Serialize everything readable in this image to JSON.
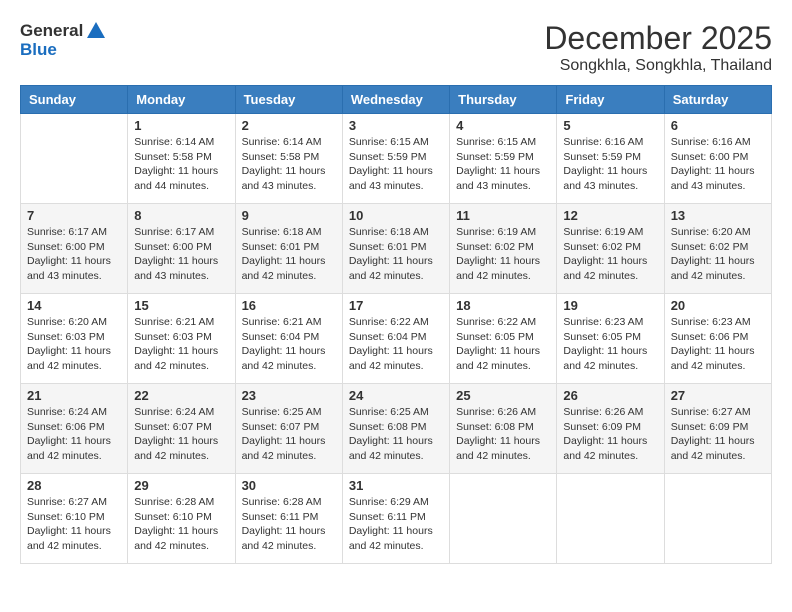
{
  "logo": {
    "general": "General",
    "blue": "Blue"
  },
  "header": {
    "month": "December 2025",
    "location": "Songkhla, Songkhla, Thailand"
  },
  "weekdays": [
    "Sunday",
    "Monday",
    "Tuesday",
    "Wednesday",
    "Thursday",
    "Friday",
    "Saturday"
  ],
  "weeks": [
    [
      {
        "day": "",
        "info": ""
      },
      {
        "day": "1",
        "info": "Sunrise: 6:14 AM\nSunset: 5:58 PM\nDaylight: 11 hours\nand 44 minutes."
      },
      {
        "day": "2",
        "info": "Sunrise: 6:14 AM\nSunset: 5:58 PM\nDaylight: 11 hours\nand 43 minutes."
      },
      {
        "day": "3",
        "info": "Sunrise: 6:15 AM\nSunset: 5:59 PM\nDaylight: 11 hours\nand 43 minutes."
      },
      {
        "day": "4",
        "info": "Sunrise: 6:15 AM\nSunset: 5:59 PM\nDaylight: 11 hours\nand 43 minutes."
      },
      {
        "day": "5",
        "info": "Sunrise: 6:16 AM\nSunset: 5:59 PM\nDaylight: 11 hours\nand 43 minutes."
      },
      {
        "day": "6",
        "info": "Sunrise: 6:16 AM\nSunset: 6:00 PM\nDaylight: 11 hours\nand 43 minutes."
      }
    ],
    [
      {
        "day": "7",
        "info": "Sunrise: 6:17 AM\nSunset: 6:00 PM\nDaylight: 11 hours\nand 43 minutes."
      },
      {
        "day": "8",
        "info": "Sunrise: 6:17 AM\nSunset: 6:00 PM\nDaylight: 11 hours\nand 43 minutes."
      },
      {
        "day": "9",
        "info": "Sunrise: 6:18 AM\nSunset: 6:01 PM\nDaylight: 11 hours\nand 42 minutes."
      },
      {
        "day": "10",
        "info": "Sunrise: 6:18 AM\nSunset: 6:01 PM\nDaylight: 11 hours\nand 42 minutes."
      },
      {
        "day": "11",
        "info": "Sunrise: 6:19 AM\nSunset: 6:02 PM\nDaylight: 11 hours\nand 42 minutes."
      },
      {
        "day": "12",
        "info": "Sunrise: 6:19 AM\nSunset: 6:02 PM\nDaylight: 11 hours\nand 42 minutes."
      },
      {
        "day": "13",
        "info": "Sunrise: 6:20 AM\nSunset: 6:02 PM\nDaylight: 11 hours\nand 42 minutes."
      }
    ],
    [
      {
        "day": "14",
        "info": "Sunrise: 6:20 AM\nSunset: 6:03 PM\nDaylight: 11 hours\nand 42 minutes."
      },
      {
        "day": "15",
        "info": "Sunrise: 6:21 AM\nSunset: 6:03 PM\nDaylight: 11 hours\nand 42 minutes."
      },
      {
        "day": "16",
        "info": "Sunrise: 6:21 AM\nSunset: 6:04 PM\nDaylight: 11 hours\nand 42 minutes."
      },
      {
        "day": "17",
        "info": "Sunrise: 6:22 AM\nSunset: 6:04 PM\nDaylight: 11 hours\nand 42 minutes."
      },
      {
        "day": "18",
        "info": "Sunrise: 6:22 AM\nSunset: 6:05 PM\nDaylight: 11 hours\nand 42 minutes."
      },
      {
        "day": "19",
        "info": "Sunrise: 6:23 AM\nSunset: 6:05 PM\nDaylight: 11 hours\nand 42 minutes."
      },
      {
        "day": "20",
        "info": "Sunrise: 6:23 AM\nSunset: 6:06 PM\nDaylight: 11 hours\nand 42 minutes."
      }
    ],
    [
      {
        "day": "21",
        "info": "Sunrise: 6:24 AM\nSunset: 6:06 PM\nDaylight: 11 hours\nand 42 minutes."
      },
      {
        "day": "22",
        "info": "Sunrise: 6:24 AM\nSunset: 6:07 PM\nDaylight: 11 hours\nand 42 minutes."
      },
      {
        "day": "23",
        "info": "Sunrise: 6:25 AM\nSunset: 6:07 PM\nDaylight: 11 hours\nand 42 minutes."
      },
      {
        "day": "24",
        "info": "Sunrise: 6:25 AM\nSunset: 6:08 PM\nDaylight: 11 hours\nand 42 minutes."
      },
      {
        "day": "25",
        "info": "Sunrise: 6:26 AM\nSunset: 6:08 PM\nDaylight: 11 hours\nand 42 minutes."
      },
      {
        "day": "26",
        "info": "Sunrise: 6:26 AM\nSunset: 6:09 PM\nDaylight: 11 hours\nand 42 minutes."
      },
      {
        "day": "27",
        "info": "Sunrise: 6:27 AM\nSunset: 6:09 PM\nDaylight: 11 hours\nand 42 minutes."
      }
    ],
    [
      {
        "day": "28",
        "info": "Sunrise: 6:27 AM\nSunset: 6:10 PM\nDaylight: 11 hours\nand 42 minutes."
      },
      {
        "day": "29",
        "info": "Sunrise: 6:28 AM\nSunset: 6:10 PM\nDaylight: 11 hours\nand 42 minutes."
      },
      {
        "day": "30",
        "info": "Sunrise: 6:28 AM\nSunset: 6:11 PM\nDaylight: 11 hours\nand 42 minutes."
      },
      {
        "day": "31",
        "info": "Sunrise: 6:29 AM\nSunset: 6:11 PM\nDaylight: 11 hours\nand 42 minutes."
      },
      {
        "day": "",
        "info": ""
      },
      {
        "day": "",
        "info": ""
      },
      {
        "day": "",
        "info": ""
      }
    ]
  ]
}
